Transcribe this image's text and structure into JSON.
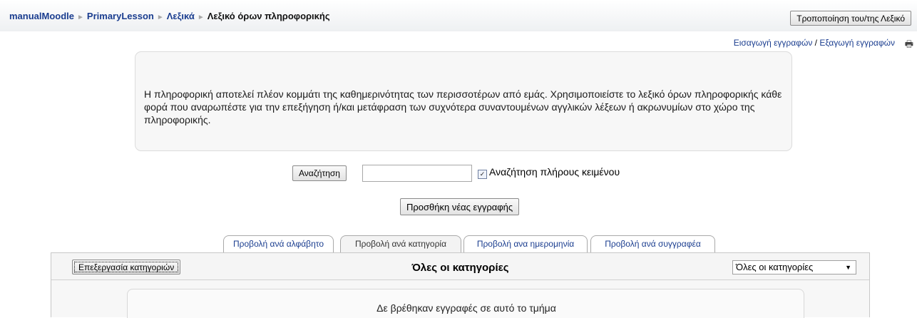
{
  "breadcrumb": {
    "items": [
      "manualMoodle",
      "PrimaryLesson",
      "Λεξικά"
    ],
    "current": "Λεξικό όρων πληροφορικής",
    "separator": "►"
  },
  "header": {
    "edit_button": "Τροποποίηση του/της Λεξικό"
  },
  "import_export": {
    "import": "Εισαγωγή εγγραφών",
    "sep": " / ",
    "export": "Εξαγωγή εγγραφών",
    "print_icon": "🖶"
  },
  "intro": {
    "text": "Η πληροφορική αποτελεί πλέον κομμάτι της καθημερινότητας των περισσοτέρων από εμάς. Χρησιμοποιείστε το λεξικό όρων πληροφορικής κάθε φορά που αναρωπέστε για την επεξήγηση ή/και μετάφραση των συχνότερα συναντουμένων αγγλικών λέξεων ή ακρωνυμίων στο χώρο της πληροφορικής."
  },
  "search": {
    "button": "Αναζήτηση",
    "input_value": "",
    "fulltext_checked": true,
    "fulltext_label": "Αναζήτηση πλήρους κειμένου",
    "check_mark": "✓"
  },
  "add_entry_button": "Προσθήκη νέας εγγραφής",
  "tabs": [
    {
      "label": "Προβολή ανά αλφάβητο",
      "active": false
    },
    {
      "label": "Προβολή ανά κατηγορία",
      "active": true
    },
    {
      "label": "Προβολή ανα ημερομηνία",
      "active": false
    },
    {
      "label": "Προβολή ανά συγγραφέα",
      "active": false
    }
  ],
  "categories": {
    "edit_button": "Επεξεργασία κατηγοριών",
    "title": "Όλες οι κατηγορίες",
    "select_value": "Όλες οι κατηγορίες",
    "empty_message": "Δε βρέθηκαν εγγραφές σε αυτό το τμήμα"
  }
}
